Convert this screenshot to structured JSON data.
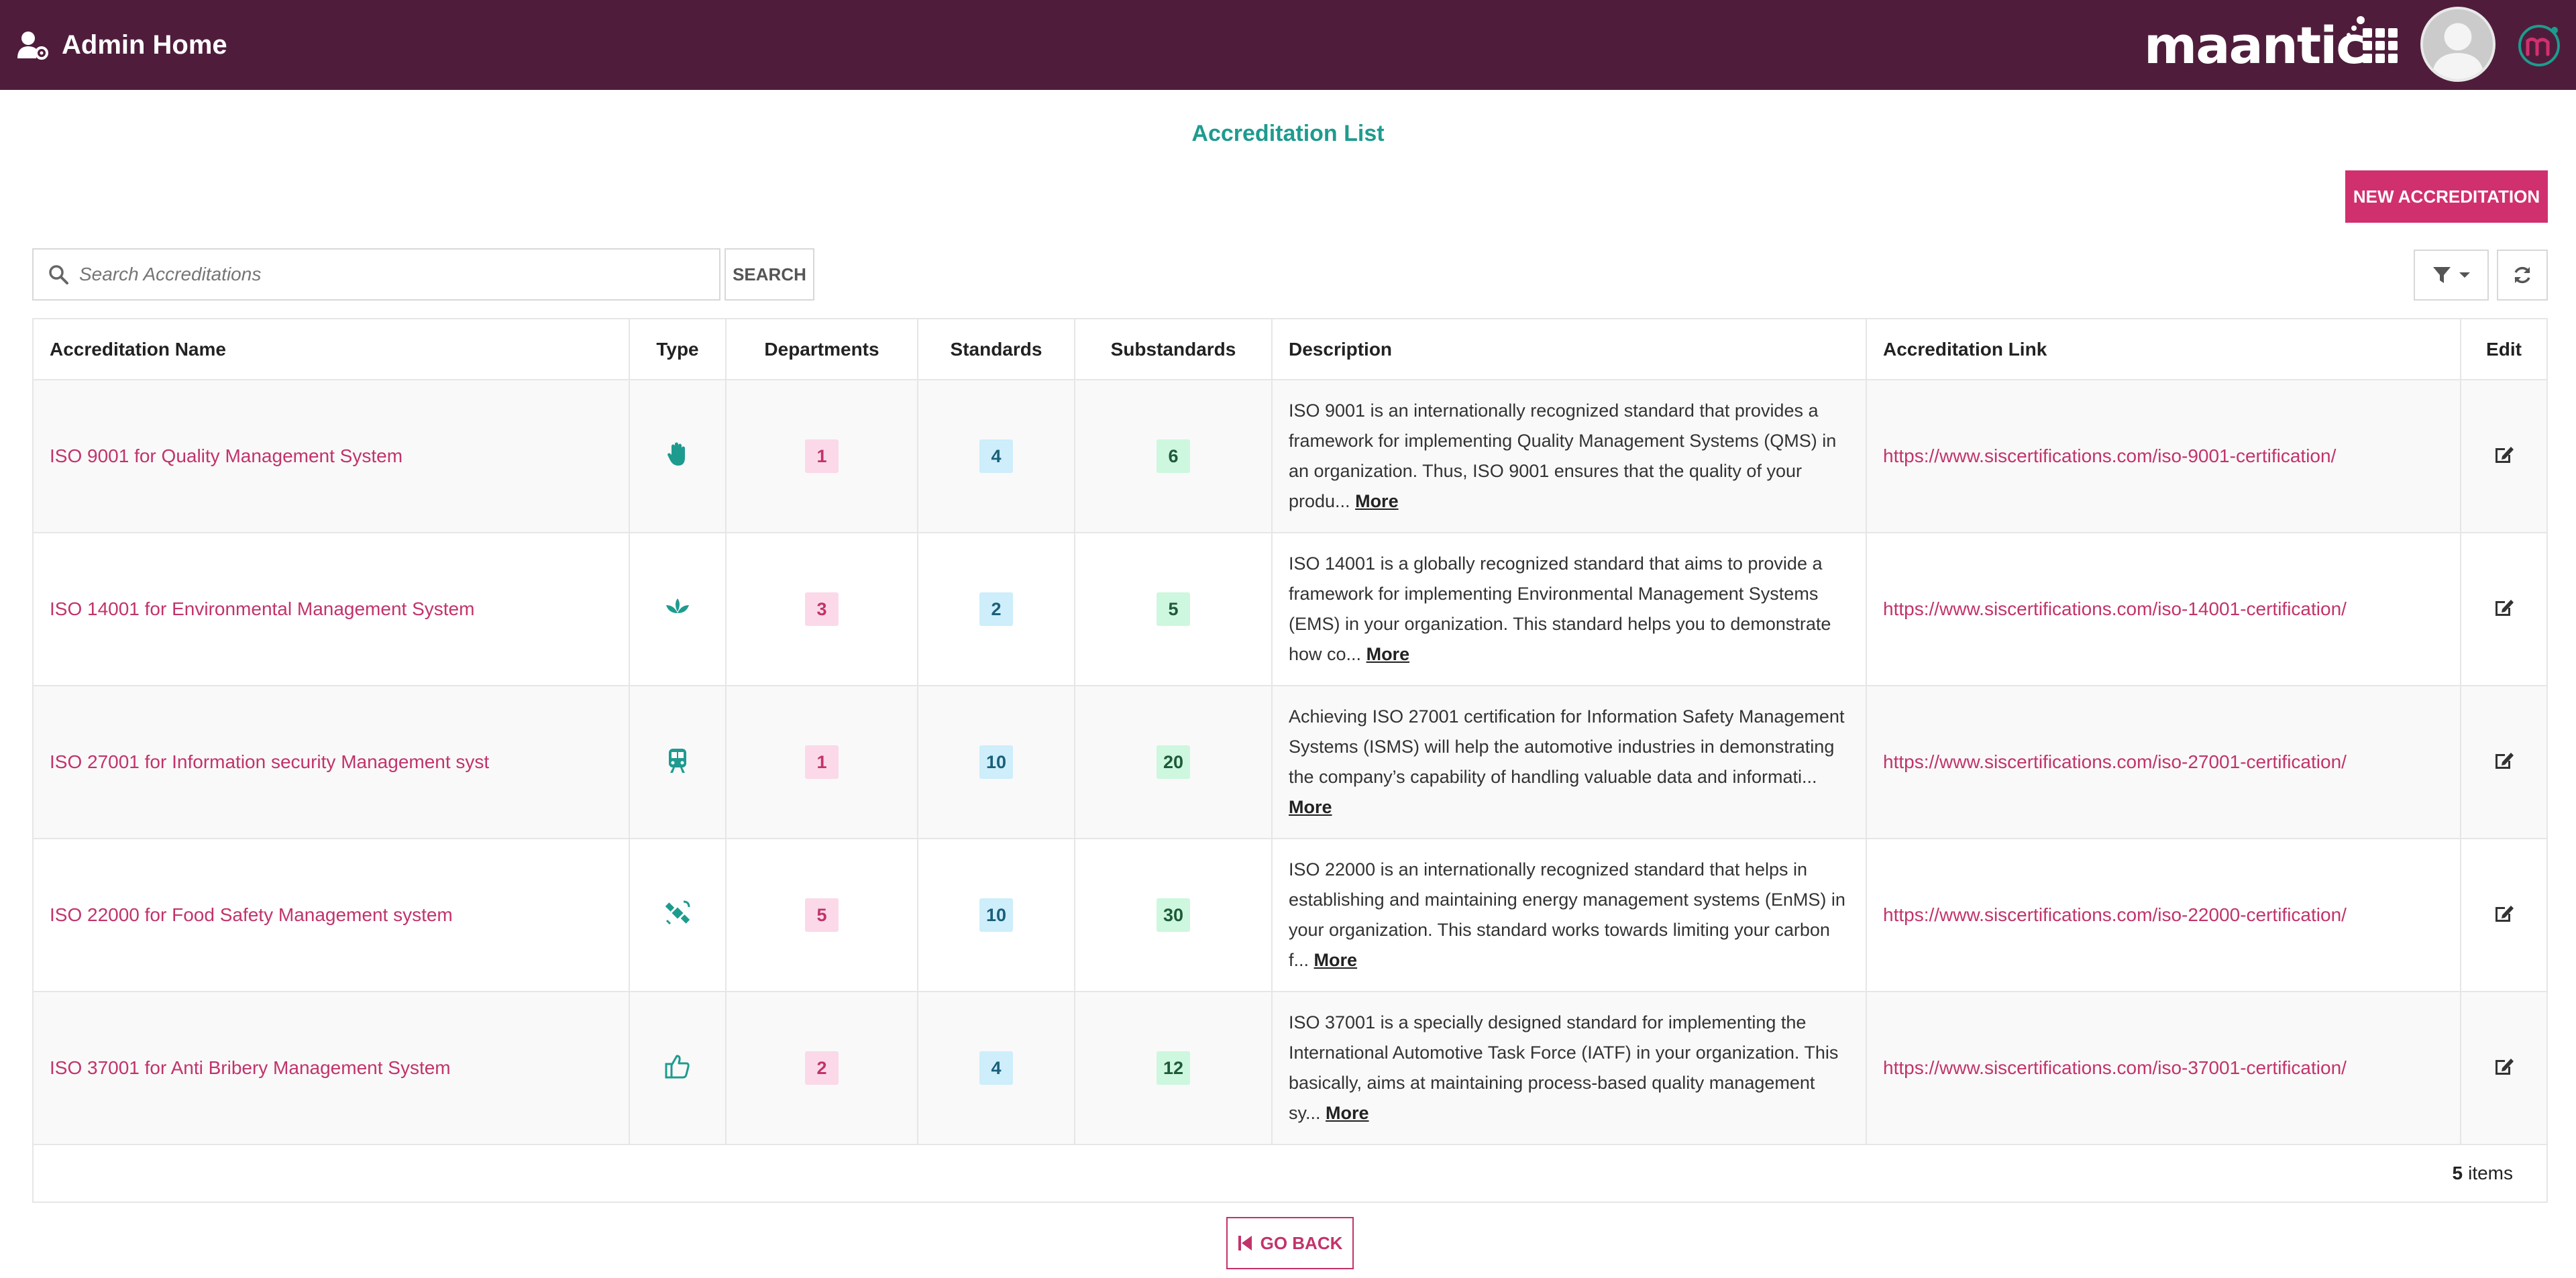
{
  "header": {
    "title": "Admin Home",
    "brand": "maantic"
  },
  "page": {
    "title": "Accreditation List",
    "new_button": "NEW ACCREDITATION"
  },
  "search": {
    "placeholder": "Search Accreditations",
    "button": "SEARCH"
  },
  "table": {
    "columns": [
      "Accreditation Name",
      "Type",
      "Departments",
      "Standards",
      "Substandards",
      "Description",
      "Accreditation Link",
      "Edit"
    ],
    "rows": [
      {
        "name": "ISO 9001 for Quality Management System",
        "type_icon": "hand-icon",
        "departments": "1",
        "standards": "4",
        "substandards": "6",
        "description": "ISO 9001 is an internationally recognized standard that provides a framework for implementing Quality Management Systems (QMS) in an organization. Thus, ISO 9001 ensures that the quality of your produ...",
        "more": "More",
        "link": "https://www.siscertifications.com/iso-9001-certification/"
      },
      {
        "name": "ISO 14001 for Environmental Management System",
        "type_icon": "lotus-icon",
        "departments": "3",
        "standards": "2",
        "substandards": "5",
        "description": "ISO 14001 is a globally recognized standard that aims to provide a framework for implementing Environmental Management Systems (EMS) in your organization. This standard helps you to demonstrate how co...",
        "more": "More",
        "link": "https://www.siscertifications.com/iso-14001-certification/"
      },
      {
        "name": "ISO 27001 for Information security Management syst",
        "type_icon": "train-icon",
        "departments": "1",
        "standards": "10",
        "substandards": "20",
        "description": "Achieving ISO 27001 certification for Information Safety Management Systems (ISMS) will help the automotive industries in demonstrating the company’s capability of handling valuable data and informati...",
        "more": "More",
        "link": "https://www.siscertifications.com/iso-27001-certification/"
      },
      {
        "name": "ISO 22000 for Food Safety Management system",
        "type_icon": "satellite-icon",
        "departments": "5",
        "standards": "10",
        "substandards": "30",
        "description": "ISO 22000 is an internationally recognized standard that helps in establishing and maintaining energy management systems (EnMS) in your organization. This standard works towards limiting your carbon f...",
        "more": "More",
        "link": "https://www.siscertifications.com/iso-22000-certification/"
      },
      {
        "name": "ISO 37001 for Anti Bribery Management System",
        "type_icon": "thumbs-up-icon",
        "departments": "2",
        "standards": "4",
        "substandards": "12",
        "description": "ISO 37001 is a specially designed standard for implementing the International Automotive Task Force (IATF) in your organization. This basically, aims at maintaining process-based quality management sy...",
        "more": "More",
        "link": "https://www.siscertifications.com/iso-37001-certification/"
      }
    ],
    "footer_count": "5",
    "footer_label": "items"
  },
  "go_back": "GO BACK",
  "colors": {
    "header_bg": "#4f1d3b",
    "accent": "#d1306f",
    "title": "#1e9b8f",
    "icon": "#1e9b8f"
  }
}
